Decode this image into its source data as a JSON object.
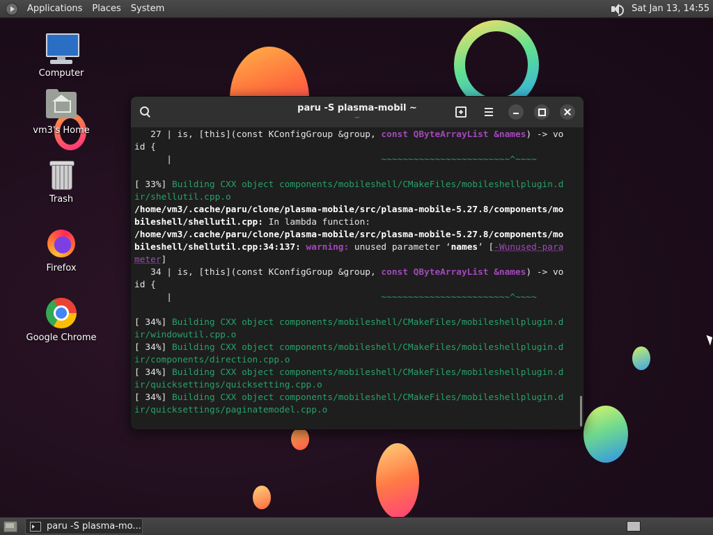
{
  "top_panel": {
    "menus": [
      "Applications",
      "Places",
      "System"
    ],
    "clock": "Sat Jan 13, 14:55"
  },
  "desktop_icons": [
    {
      "label": "Computer",
      "icon": "computer-icon"
    },
    {
      "label": "vm3's Home",
      "icon": "home-folder-icon"
    },
    {
      "label": "Trash",
      "icon": "trash-icon"
    },
    {
      "label": "Firefox",
      "icon": "firefox-icon"
    },
    {
      "label": "Google Chrome",
      "icon": "chrome-icon"
    }
  ],
  "terminal": {
    "title": "paru -S plasma-mobil ~",
    "subtitle": "~",
    "lines": [
      [
        {
          "t": "   27 | is, [this](const KConfigGroup &group, "
        },
        {
          "t": "const QByteArrayList &names",
          "c": "kw"
        },
        {
          "t": ") -> vo"
        }
      ],
      [
        {
          "t": "id {"
        }
      ],
      [
        {
          "t": "      |                                       "
        },
        {
          "t": "~~~~~~~~~~~~~~~~~~~~~~~~^~~~~",
          "c": "tilde"
        }
      ],
      [
        {
          "t": ""
        }
      ],
      [
        {
          "t": "[ 33%] "
        },
        {
          "t": "Building CXX object components/mobileshell/CMakeFiles/mobileshellplugin.d",
          "c": "g"
        }
      ],
      [
        {
          "t": "ir/shellutil.cpp.o",
          "c": "g"
        }
      ],
      [
        {
          "t": "/home/vm3/.cache/paru/clone/plasma-mobile/src/plasma-mobile-5.27.8/components/mo",
          "c": "bw"
        }
      ],
      [
        {
          "t": "bileshell/shellutil.cpp:",
          "c": "bw"
        },
        {
          "t": " In lambda function:"
        }
      ],
      [
        {
          "t": "/home/vm3/.cache/paru/clone/plasma-mobile/src/plasma-mobile-5.27.8/components/mo",
          "c": "bw"
        }
      ],
      [
        {
          "t": "bileshell/shellutil.cpp:34:137: ",
          "c": "bw"
        },
        {
          "t": "warning:",
          "c": "warn"
        },
        {
          "t": " unused parameter ‘"
        },
        {
          "t": "names",
          "c": "bw"
        },
        {
          "t": "’ ["
        },
        {
          "t": "-Wunused-para",
          "c": "flag"
        }
      ],
      [
        {
          "t": "meter",
          "c": "flag"
        },
        {
          "t": "]"
        }
      ],
      [
        {
          "t": "   34 | is, [this](const KConfigGroup &group, "
        },
        {
          "t": "const QByteArrayList &names",
          "c": "kw"
        },
        {
          "t": ") -> vo"
        }
      ],
      [
        {
          "t": "id {"
        }
      ],
      [
        {
          "t": "      |                                       "
        },
        {
          "t": "~~~~~~~~~~~~~~~~~~~~~~~~^~~~~",
          "c": "tilde"
        }
      ],
      [
        {
          "t": ""
        }
      ],
      [
        {
          "t": "[ 34%] "
        },
        {
          "t": "Building CXX object components/mobileshell/CMakeFiles/mobileshellplugin.d",
          "c": "g"
        }
      ],
      [
        {
          "t": "ir/windowutil.cpp.o",
          "c": "g"
        }
      ],
      [
        {
          "t": "[ 34%] "
        },
        {
          "t": "Building CXX object components/mobileshell/CMakeFiles/mobileshellplugin.d",
          "c": "g"
        }
      ],
      [
        {
          "t": "ir/components/direction.cpp.o",
          "c": "g"
        }
      ],
      [
        {
          "t": "[ 34%] "
        },
        {
          "t": "Building CXX object components/mobileshell/CMakeFiles/mobileshellplugin.d",
          "c": "g"
        }
      ],
      [
        {
          "t": "ir/quicksettings/quicksetting.cpp.o",
          "c": "g"
        }
      ],
      [
        {
          "t": "[ 34%] "
        },
        {
          "t": "Building CXX object components/mobileshell/CMakeFiles/mobileshellplugin.d",
          "c": "g"
        }
      ],
      [
        {
          "t": "ir/quicksettings/paginatemodel.cpp.o",
          "c": "g"
        }
      ]
    ]
  },
  "taskbar": {
    "task_label": "paru -S plasma-mo..."
  },
  "colors": {
    "terminal_green": "#26a269",
    "terminal_purple": "#a347ba",
    "panel_bg": "#3f3f3f"
  }
}
